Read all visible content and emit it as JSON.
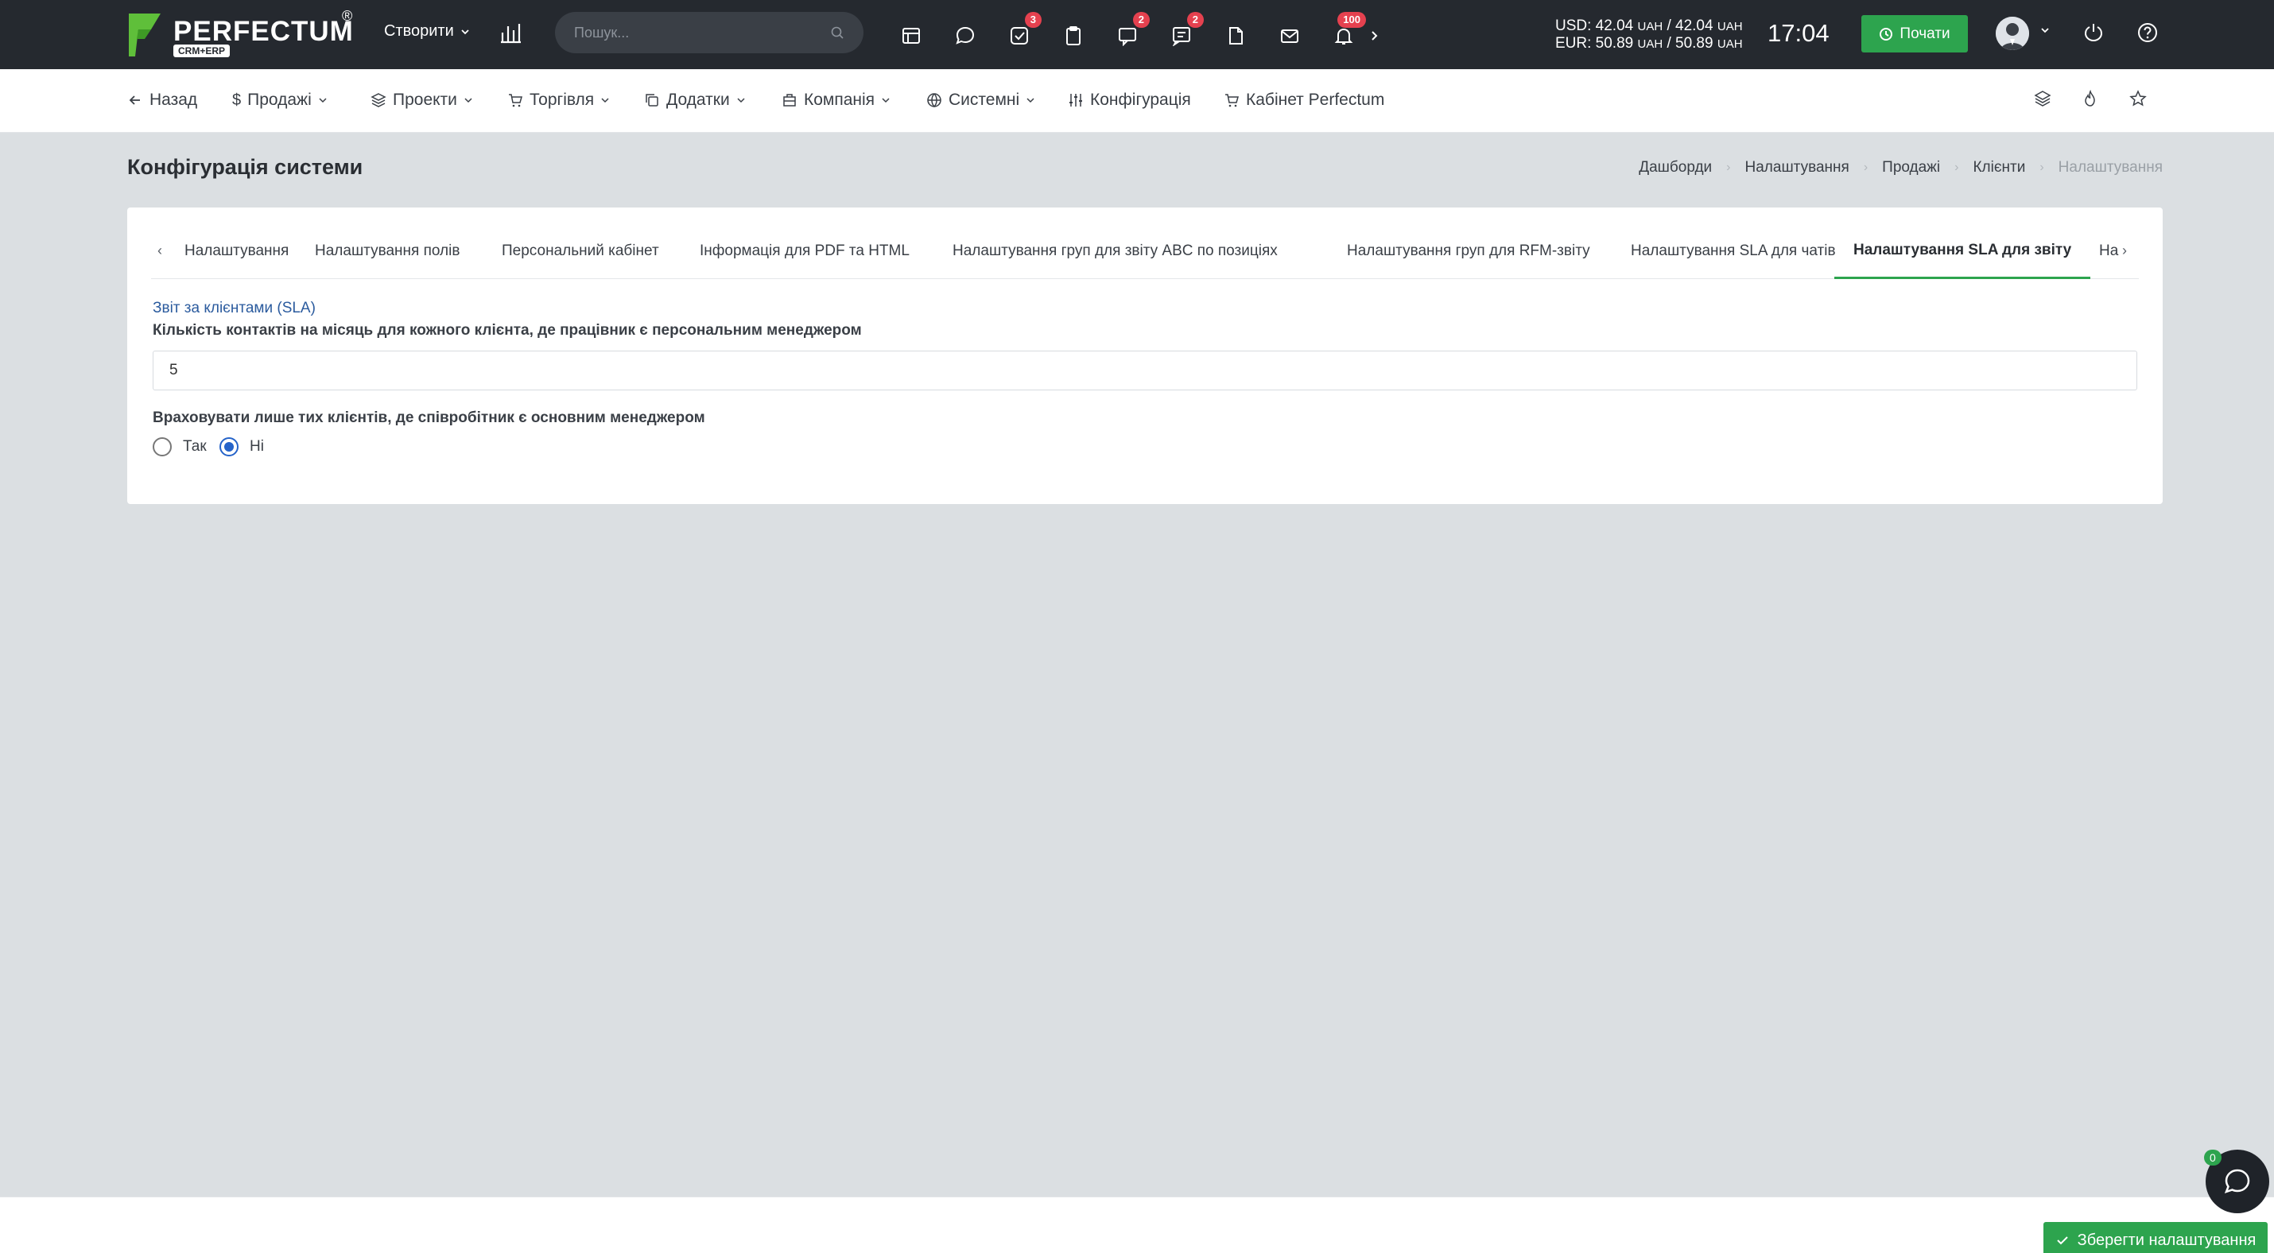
{
  "topbar": {
    "logo_text": "PERFECTUM",
    "logo_sub": "CRM+ERP",
    "create_label": "Створити",
    "search_placeholder": "Пошук...",
    "badges": {
      "tasks": "3",
      "chats": "2",
      "messages": "2",
      "notifications": "100"
    },
    "rates": {
      "usd": "USD: 42.04",
      "usd_mid": " / 42.04",
      "eur": "EUR: 50.89",
      "eur_mid": " / 50.89",
      "unit": "UAH"
    },
    "clock": "17:04",
    "start_label": "Почати"
  },
  "nav": {
    "back": "Назад",
    "sales": "Продажі",
    "projects": "Проекти",
    "trade": "Торгівля",
    "addons": "Додатки",
    "company": "Компанія",
    "system": "Системні",
    "config": "Конфігурація",
    "cabinet": "Кабінет Perfectum"
  },
  "page": {
    "title": "Конфігурація системи",
    "breadcrumb": [
      "Дашборди",
      "Налаштування",
      "Продажі",
      "Клієнти",
      "Налаштування"
    ]
  },
  "tabs": [
    "Налаштування",
    "Налаштування полів",
    "Персональний кабінет",
    "Інформація для PDF та HTML",
    "Налаштування груп для звіту ABC по позиціях",
    "Налаштування груп для RFM-звіту",
    "Налаштування SLA для чатів",
    "Налаштування SLA для звіту",
    "На"
  ],
  "form": {
    "section_label": "Звіт за клієнтами (SLA)",
    "contacts_label": "Кількість контактів на місяць для кожного клієнта, де працівник є персональним менеджером",
    "contacts_value": "5",
    "main_manager_label": "Враховувати лише тих клієнтів, де співробітник є основним менеджером",
    "option_yes": "Так",
    "option_no": "Ні",
    "selected": "Ні"
  },
  "footer": {
    "save_label": "Зберегти налаштування",
    "chat_count": "0"
  },
  "colors": {
    "accent": "#2da44e",
    "topbar": "#25292f",
    "badge": "#e5414f",
    "link": "#2b5b9e"
  }
}
